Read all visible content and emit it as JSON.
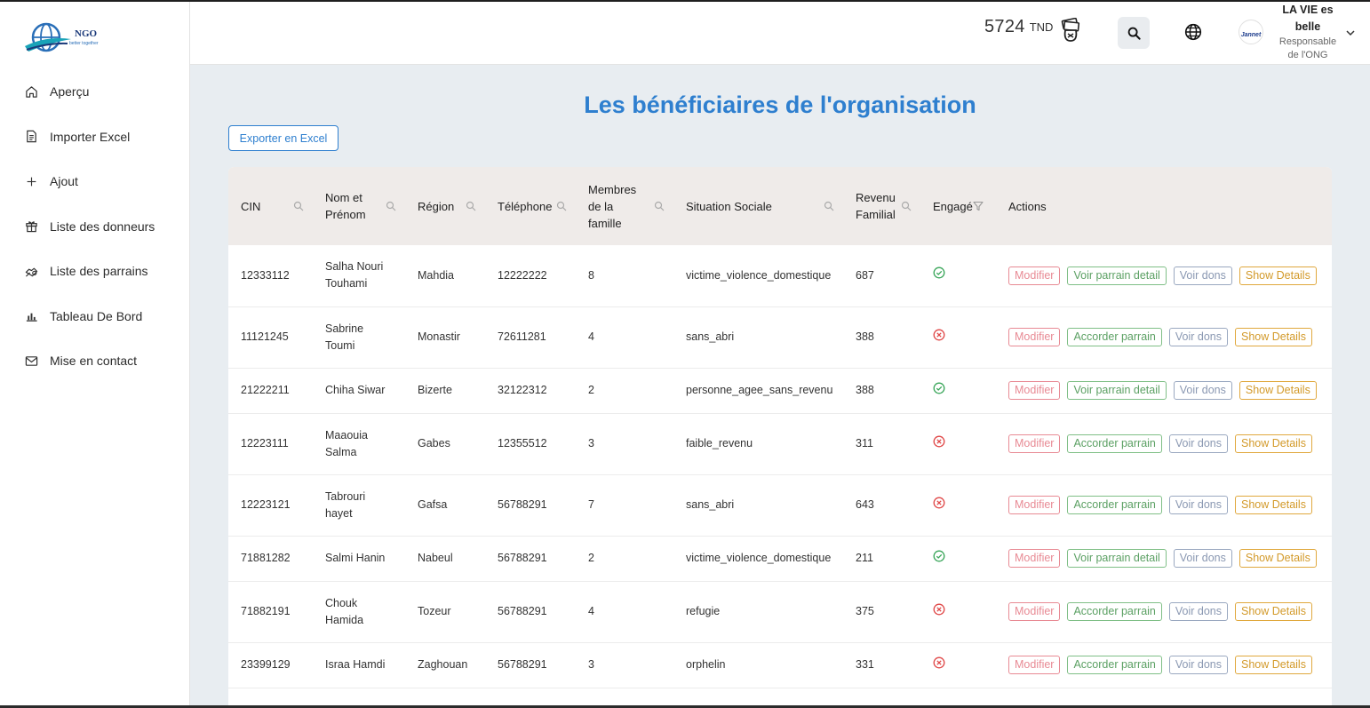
{
  "logo": {
    "text": "NGO",
    "tagline": "better together"
  },
  "sidebar": {
    "items": [
      {
        "label": "Aperçu",
        "icon": "home-icon"
      },
      {
        "label": "Importer Excel",
        "icon": "file-icon"
      },
      {
        "label": "Ajout",
        "icon": "plus-icon"
      },
      {
        "label": "Liste des donneurs",
        "icon": "gift-icon"
      },
      {
        "label": "Liste des parrains",
        "icon": "handshake-icon"
      },
      {
        "label": "Tableau De Bord",
        "icon": "chart-icon"
      },
      {
        "label": "Mise en contact",
        "icon": "mail-icon"
      }
    ]
  },
  "header": {
    "balance": "5724",
    "currency": "TND",
    "user_name": "LA VIE es belle",
    "user_role": "Responsable de l'ONG",
    "avatar_text": "Jannet"
  },
  "main": {
    "title": "Les bénéficiaires de l'organisation",
    "export_label": "Exporter en Excel"
  },
  "table": {
    "columns": [
      "CIN",
      "Nom et Prénom",
      "Région",
      "Téléphone",
      "Membres de la famille",
      "Situation Sociale",
      "Revenu Familial",
      "Engagé",
      "Actions"
    ],
    "rows": [
      {
        "cin": "12333112",
        "name": "Salha Nouri Touhami",
        "region": "Mahdia",
        "phone": "12222222",
        "members": "8",
        "situation": "victime_violence_domestique",
        "revenu": "687",
        "engaged": true,
        "parrain_label": "Voir parrain detail"
      },
      {
        "cin": "11121245",
        "name": "Sabrine Toumi",
        "region": "Monastir",
        "phone": "72611281",
        "members": "4",
        "situation": "sans_abri",
        "revenu": "388",
        "engaged": false,
        "parrain_label": "Accorder parrain"
      },
      {
        "cin": "21222211",
        "name": "Chiha Siwar",
        "region": "Bizerte",
        "phone": "32122312",
        "members": "2",
        "situation": "personne_agee_sans_revenu",
        "revenu": "388",
        "engaged": true,
        "parrain_label": "Voir parrain detail"
      },
      {
        "cin": "12223111",
        "name": "Maaouia Salma",
        "region": "Gabes",
        "phone": "12355512",
        "members": "3",
        "situation": "faible_revenu",
        "revenu": "311",
        "engaged": false,
        "parrain_label": "Accorder parrain"
      },
      {
        "cin": "12223121",
        "name": "Tabrouri hayet",
        "region": "Gafsa",
        "phone": "56788291",
        "members": "7",
        "situation": "sans_abri",
        "revenu": "643",
        "engaged": false,
        "parrain_label": "Accorder parrain"
      },
      {
        "cin": "71881282",
        "name": "Salmi Hanin",
        "region": "Nabeul",
        "phone": "56788291",
        "members": "2",
        "situation": "victime_violence_domestique",
        "revenu": "211",
        "engaged": true,
        "parrain_label": "Voir parrain detail"
      },
      {
        "cin": "71882191",
        "name": "Chouk Hamida",
        "region": "Tozeur",
        "phone": "56788291",
        "members": "4",
        "situation": "refugie",
        "revenu": "375",
        "engaged": false,
        "parrain_label": "Accorder parrain"
      },
      {
        "cin": "23399129",
        "name": "Israa Hamdi",
        "region": "Zaghouan",
        "phone": "56788291",
        "members": "3",
        "situation": "orphelin",
        "revenu": "331",
        "engaged": false,
        "parrain_label": "Accorder parrain"
      }
    ],
    "actions": {
      "modify": "Modifier",
      "dons": "Voir dons",
      "details": "Show Details"
    }
  },
  "colors": {
    "title": "#2e7fcf",
    "engaged_yes": "#3aa65a",
    "engaged_no": "#e04848",
    "header_bg": "#efebe9"
  }
}
